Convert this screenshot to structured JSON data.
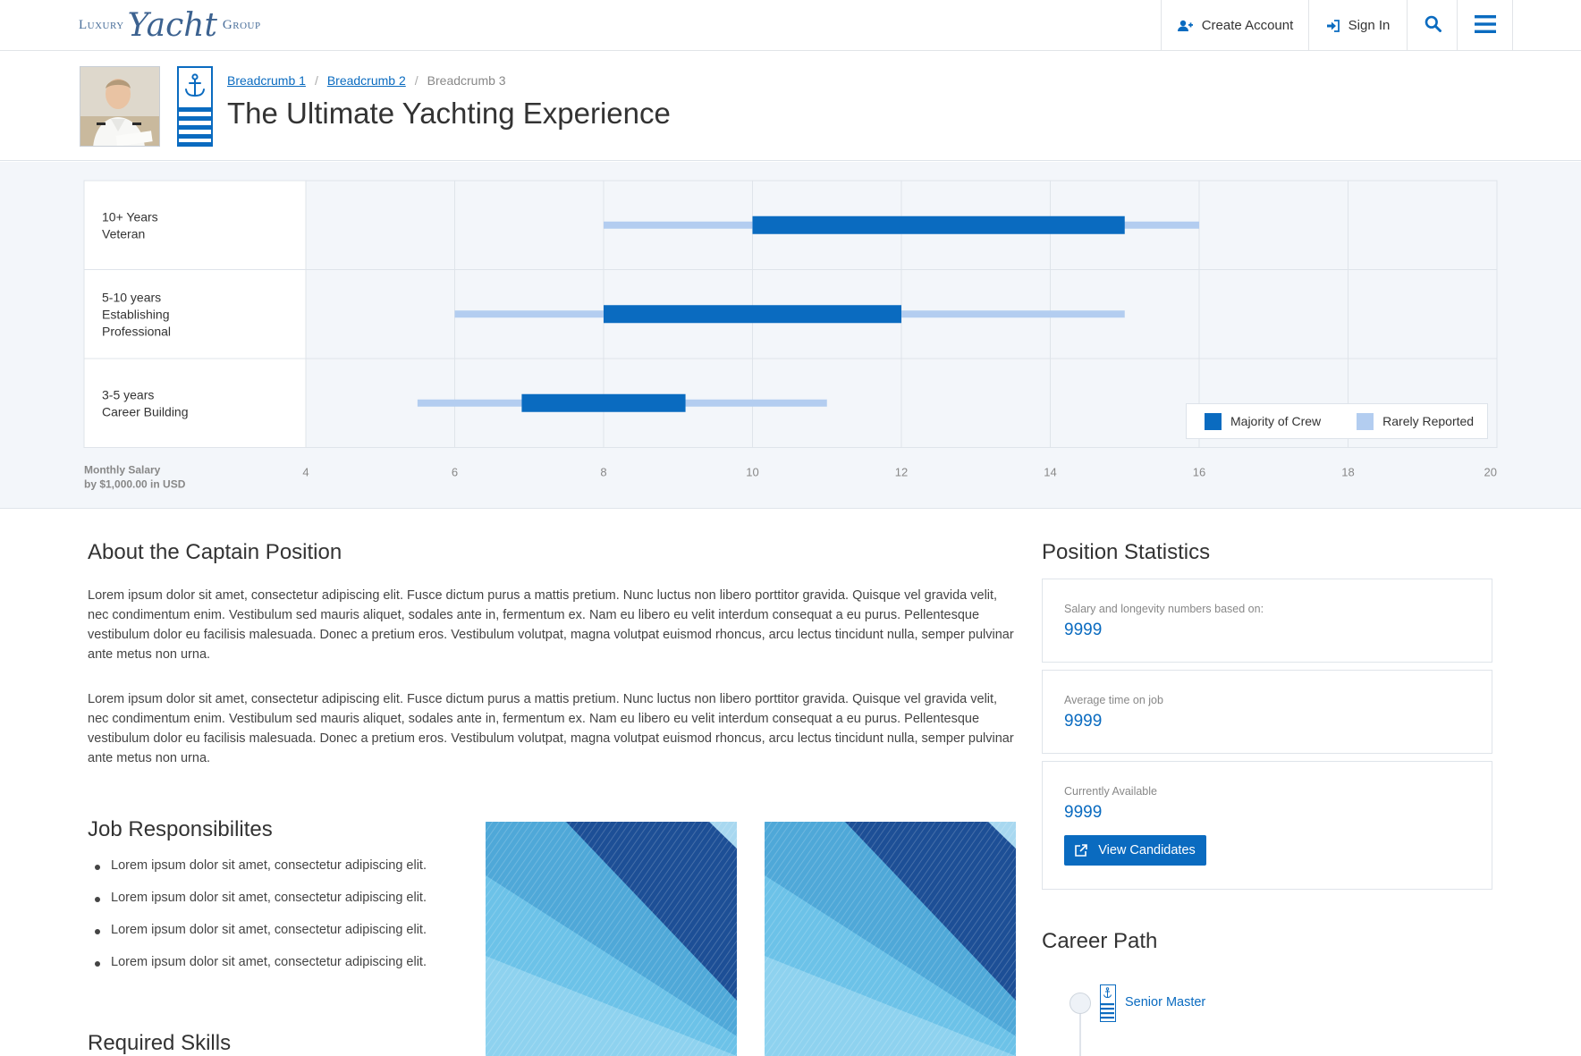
{
  "header": {
    "logo": {
      "prefix": "Luxury",
      "main": "Yacht",
      "suffix": "Group"
    },
    "create_account": "Create Account",
    "sign_in": "Sign In"
  },
  "breadcrumb": [
    "Breadcrumb 1",
    "Breadcrumb 2",
    "Breadcrumb 3"
  ],
  "page_title": "The Ultimate Yachting Experience",
  "chart_data": {
    "type": "bar",
    "orientation": "horizontal",
    "categories": [
      {
        "bold": "10+ Years",
        "sub": [
          "Veteran"
        ]
      },
      {
        "bold": "5-10 years",
        "sub": [
          "Establishing",
          "Professional"
        ]
      },
      {
        "bold": "3-5 years",
        "sub": [
          "Career Building"
        ]
      }
    ],
    "series": [
      {
        "name": "Majority of Crew",
        "color": "#0a6bc0",
        "ranges": [
          [
            10,
            15
          ],
          [
            8,
            12
          ],
          [
            6.9,
            9.1
          ]
        ]
      },
      {
        "name": "Rarely Reported",
        "color": "#b3cdf0",
        "ranges": [
          [
            8,
            16
          ],
          [
            6,
            15
          ],
          [
            5.5,
            11
          ]
        ]
      }
    ],
    "xlabel": [
      "Monthly Salary",
      "by $1,000.00 in USD"
    ],
    "x_ticks": [
      4,
      6,
      8,
      10,
      12,
      14,
      16,
      18,
      20
    ],
    "xlim": [
      4,
      20
    ],
    "grid": true,
    "legend_position": "bottom-right"
  },
  "about": {
    "title": "About the Captain Position",
    "paragraphs": [
      "Lorem ipsum dolor sit amet, consectetur adipiscing elit. Fusce dictum purus a mattis pretium. Nunc luctus non libero porttitor gravida. Quisque vel gravida velit, nec condimentum enim. Vestibulum sed mauris aliquet, sodales ante in, fermentum ex. Nam eu libero eu velit interdum consequat a eu purus. Pellentesque vestibulum dolor eu facilisis malesuada. Donec a pretium eros. Vestibulum volutpat, magna volutpat euismod rhoncus, arcu lectus tincidunt nulla, semper pulvinar ante metus non urna.",
      "Lorem ipsum dolor sit amet, consectetur adipiscing elit. Fusce dictum purus a mattis pretium. Nunc luctus non libero porttitor gravida. Quisque vel gravida velit, nec condimentum enim. Vestibulum sed mauris aliquet, sodales ante in, fermentum ex. Nam eu libero eu velit interdum consequat a eu purus. Pellentesque vestibulum dolor eu facilisis malesuada. Donec a pretium eros. Vestibulum volutpat, magna volutpat euismod rhoncus, arcu lectus tincidunt nulla, semper pulvinar ante metus non urna."
    ]
  },
  "responsibilities": {
    "title": "Job Responsibilites",
    "items": [
      "Lorem ipsum dolor sit amet, consectetur adipiscing elit.",
      "Lorem ipsum dolor sit amet, consectetur adipiscing elit.",
      "Lorem ipsum dolor sit amet, consectetur adipiscing elit.",
      "Lorem ipsum dolor sit amet, consectetur adipiscing elit."
    ]
  },
  "skills": {
    "title": "Required Skills"
  },
  "stats": {
    "title": "Position Statistics",
    "cards": [
      {
        "label": "Salary and longevity numbers based on:",
        "value": "9999"
      },
      {
        "label": "Average time on job",
        "value": "9999"
      },
      {
        "label": "Currently Available",
        "value": "9999",
        "button": "View Candidates"
      }
    ]
  },
  "career": {
    "title": "Career Path",
    "items": [
      "Senior Master"
    ]
  },
  "colors": {
    "accent": "#0a6bc0",
    "light": "#b3cdf0",
    "band": "#f3f6fa"
  }
}
